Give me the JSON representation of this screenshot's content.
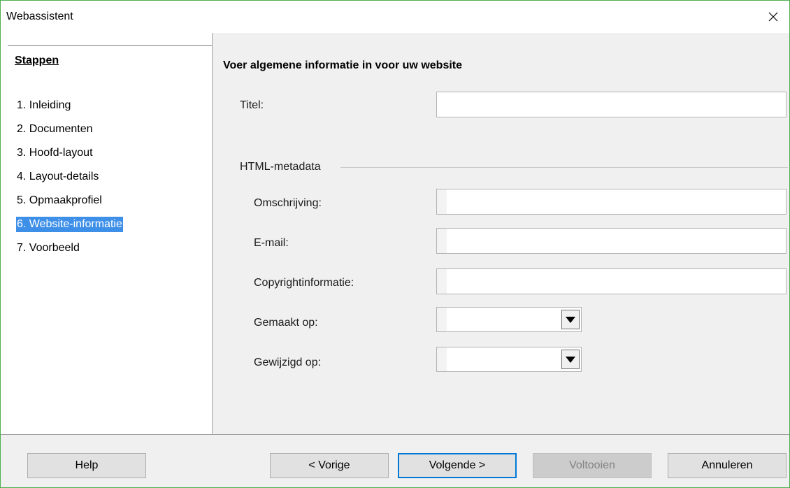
{
  "window": {
    "title": "Webassistent"
  },
  "sidebar": {
    "heading": "Stappen",
    "steps": [
      {
        "label": "1. Inleiding",
        "selected": false
      },
      {
        "label": "2. Documenten",
        "selected": false
      },
      {
        "label": "3. Hoofd-layout",
        "selected": false
      },
      {
        "label": "4. Layout-details",
        "selected": false
      },
      {
        "label": "5. Opmaakprofiel",
        "selected": false
      },
      {
        "label": "6. Website-informatie",
        "selected": true
      },
      {
        "label": "7. Voorbeeld",
        "selected": false
      }
    ]
  },
  "content": {
    "title": "Voer algemene informatie in voor uw website",
    "titel_label": "Titel:",
    "titel_value": "",
    "group_label": "HTML-metadata",
    "description_label": "Omschrijving:",
    "description_value": "",
    "email_label": "E-mail:",
    "email_value": "",
    "copyright_label": "Copyrightinformatie:",
    "copyright_value": "",
    "created_label": "Gemaakt op:",
    "created_value": "",
    "modified_label": "Gewijzigd op:",
    "modified_value": ""
  },
  "footer": {
    "help_label": "Help",
    "back_label": "< Vorige",
    "next_label": "Volgende >",
    "finish_label": "Voltooien",
    "cancel_label": "Annuleren"
  },
  "colors": {
    "selection": "#3d8fe8",
    "window_border": "#4caf50",
    "default_button_border": "#0078d7"
  },
  "icons": {
    "close": "close-icon",
    "dropdown": "dropdown-arrow-icon"
  }
}
